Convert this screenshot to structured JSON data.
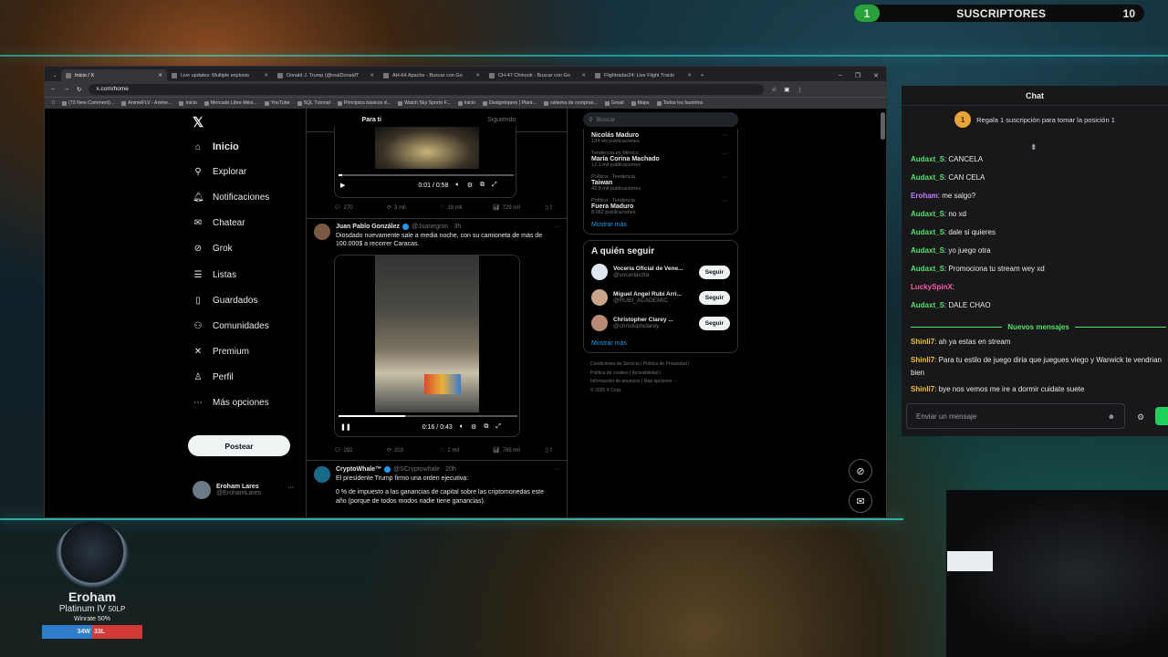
{
  "subs": {
    "count_left": "1",
    "label": "SUSCRIPTORES",
    "count_right": "10"
  },
  "browser": {
    "tabs": [
      {
        "label": "Inicio / X",
        "active": true
      },
      {
        "label": "Live updates: Multiple explosio"
      },
      {
        "label": "Donald J. Trump (@realDonaldT"
      },
      {
        "label": "AH-64 Apache - Buscar con Go"
      },
      {
        "label": "CH-47 Chinook - Buscar con Go"
      },
      {
        "label": "Flightradar24: Live Flight Tracki"
      }
    ],
    "url": "x.com/home",
    "bookmarks": [
      "(73 New Comment)...",
      "AnimeFLV - Anime...",
      "Inicio",
      "Mercado Libre Méxi...",
      "YouTube",
      "SQL Tutorial",
      "Principios básicos d...",
      "Watch Sky Sports F...",
      "Inicio",
      "Designtopers | Plant...",
      "sistema de compras...",
      "Gmail",
      "Maps",
      "Todos los favoritos"
    ]
  },
  "nav": {
    "items": [
      {
        "label": "Inicio",
        "icon": "home-icon",
        "glyph": "⌂"
      },
      {
        "label": "Explorar",
        "icon": "search-icon",
        "glyph": "⚲"
      },
      {
        "label": "Notificaciones",
        "icon": "bell-icon",
        "glyph": "🔔︎"
      },
      {
        "label": "Chatear",
        "icon": "mail-icon",
        "glyph": "✉"
      },
      {
        "label": "Grok",
        "icon": "grok-icon",
        "glyph": "⊘"
      },
      {
        "label": "Listas",
        "icon": "list-icon",
        "glyph": "☰"
      },
      {
        "label": "Guardados",
        "icon": "bookmark-icon",
        "glyph": "▯"
      },
      {
        "label": "Comunidades",
        "icon": "people-icon",
        "glyph": "⚇"
      },
      {
        "label": "Premium",
        "icon": "x-icon",
        "glyph": "✕"
      },
      {
        "label": "Perfil",
        "icon": "person-icon",
        "glyph": "♙"
      },
      {
        "label": "Más opciones",
        "icon": "more-icon",
        "glyph": "⋯"
      }
    ],
    "post": "Postear",
    "user_name": "Eroham Lares",
    "user_handle": "@ErohamLares"
  },
  "feed": {
    "tabs": [
      "Para ti",
      "Siguiendo"
    ],
    "video1": {
      "time": "0:01 / 0:58",
      "progress": 0.02
    },
    "actions1": [
      "270",
      "3 mil",
      "18 mil",
      "729 mil"
    ],
    "tweet2": {
      "name": "Juan Pablo González",
      "handle": "@Juanegron · 3h",
      "text": "Diosdado nuevamente sale a media noche, con su camioneta de más de 100.000$ a recorrer Caracas.",
      "time": "0:16 / 0:43",
      "progress": 0.37
    },
    "actions2": [
      "292",
      "203",
      "2 mil",
      "769 mil"
    ],
    "tweet3": {
      "name": "CryptoWhale™",
      "handle": "@SCryptowhale · 20h",
      "text1": "El presidente Trump firmo una orden ejecutiva:",
      "text2": "0 % de impuesto a las ganancias de capital sobre las criptomonedas este año (porque de todos modos nadie tiene ganancias)."
    }
  },
  "right": {
    "search_placeholder": "Buscar",
    "trends": [
      {
        "cat": "",
        "title": "Nicolás Maduro",
        "posts": "134 mil publicaciones"
      },
      {
        "cat": "Tendencia en México",
        "title": "María Corina Machado",
        "posts": "12,1 mil publicaciones"
      },
      {
        "cat": "Política · Tendencia",
        "title": "Taiwan",
        "posts": "43,8 mil publicaciones"
      },
      {
        "cat": "Política · Tendencia",
        "title": "Fuera Maduro",
        "posts": "8.062 publicaciones"
      }
    ],
    "show_more": "Mostrar más",
    "who_title": "A quién seguir",
    "who": [
      {
        "name": "Vocería Oficial de Vene...",
        "handle": "@vocerlavzla",
        "color": "#dfe7f3"
      },
      {
        "name": "Miguel Angel Rubí Arri...",
        "handle": "@RUBI_ACADEMIC",
        "color": "#c9a58a"
      },
      {
        "name": "Christopher Clarey ...",
        "handle": "@christophclarey",
        "color": "#b98a78"
      }
    ],
    "follow": "Seguir",
    "show_more2": "Mostrar más",
    "footer": [
      "Condiciones de Servicio  |  Política de Privacidad  |",
      "Política de cookies  |  Accesibilidad  |",
      "Información de anuncios  |  Más opciones ···",
      "© 2025 X Corp."
    ]
  },
  "chat": {
    "title": "Chat",
    "gift_num": "1",
    "gift": "Regala 1 suscripción para tomar la posición 1",
    "messages": [
      {
        "user": "Audaxt_S",
        "text": ": CANCELA",
        "color": "#56e06a"
      },
      {
        "user": "Audaxt_S",
        "text": ": CAN CELA",
        "color": "#56e06a"
      },
      {
        "user": "Eroham",
        "text": ": me salgo?",
        "color": "#c67cff"
      },
      {
        "user": "Audaxt_S",
        "text": ": no xd",
        "color": "#56e06a"
      },
      {
        "user": "Audaxt_S",
        "text": ": dale si quieres",
        "color": "#56e06a"
      },
      {
        "user": "Audaxt_S",
        "text": ": yo juego otra",
        "color": "#56e06a"
      },
      {
        "user": "Audaxt_S",
        "text": ": Promociona tu stream wey xd",
        "color": "#56e06a"
      },
      {
        "user": "LuckySpinX",
        "text": ":",
        "color": "#ff5aa8"
      },
      {
        "user": "Audaxt_S",
        "text": ": DALE CHAO",
        "color": "#56e06a"
      }
    ],
    "new_label": "Nuevos mensajes",
    "new_messages": [
      {
        "user": "Shinli7",
        "text": ": ah ya estas en stream",
        "color": "#f0c040"
      },
      {
        "user": "Shinli7",
        "text": ": Para tu estilo de juego diria que juegues viego y Warwick te vendrian bien",
        "color": "#f0c040"
      },
      {
        "user": "Shinli7",
        "text": ": bye nos vemos me ire a dormir cuidate suete",
        "color": "#f0c040"
      }
    ],
    "input_placeholder": "Enviar un mensaje"
  },
  "rank": {
    "name": "Eroham",
    "tier": "Platinum IV",
    "lp": "50LP",
    "winrate": "Winrate 50%",
    "wins": "34W",
    "losses": "33L",
    "win_frac": 0.5
  }
}
